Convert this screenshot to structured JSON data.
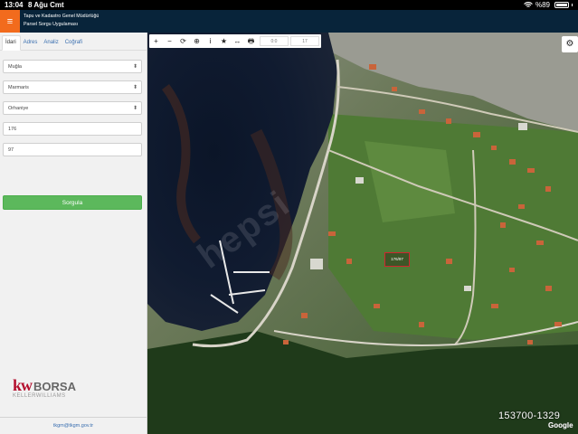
{
  "status_bar": {
    "time": "13:04",
    "date": "8 Ağu Cmt",
    "battery": "%89",
    "wifi_icon": "wifi-icon",
    "battery_icon": "battery-icon"
  },
  "header": {
    "menu_icon": "≡",
    "title_line1": "Tapu ve Kadastro Genel Müdürlüğü",
    "title_line2": "Parsel Sorgu Uygulaması"
  },
  "sidebar": {
    "tabs": [
      {
        "label": "İdari"
      },
      {
        "label": "Adres"
      },
      {
        "label": "Analiz"
      },
      {
        "label": "Coğrafi"
      }
    ],
    "fields": {
      "province": "Muğla",
      "district": "Marmaris",
      "neighborhood": "Orhaniye",
      "block": "176",
      "parcel": "97"
    },
    "query_button": "Sorgula",
    "logo": {
      "kw": "kw",
      "brand": "BORSA",
      "subtitle": "KELLERWILLIAMS"
    },
    "footer_email": "tkgm@tkgm.gov.tr"
  },
  "map": {
    "toolbar": {
      "tools": [
        "+",
        "−",
        "⟳",
        "⊕",
        "i",
        "★",
        "↔",
        "🖶"
      ],
      "coord_x": "0:0",
      "coord_y": "17"
    },
    "settings_icon": "gear-icon",
    "parcel_label": "176/97",
    "listing_code": "153700-1329",
    "google_logo": "Google",
    "watermark": "hepsi"
  }
}
